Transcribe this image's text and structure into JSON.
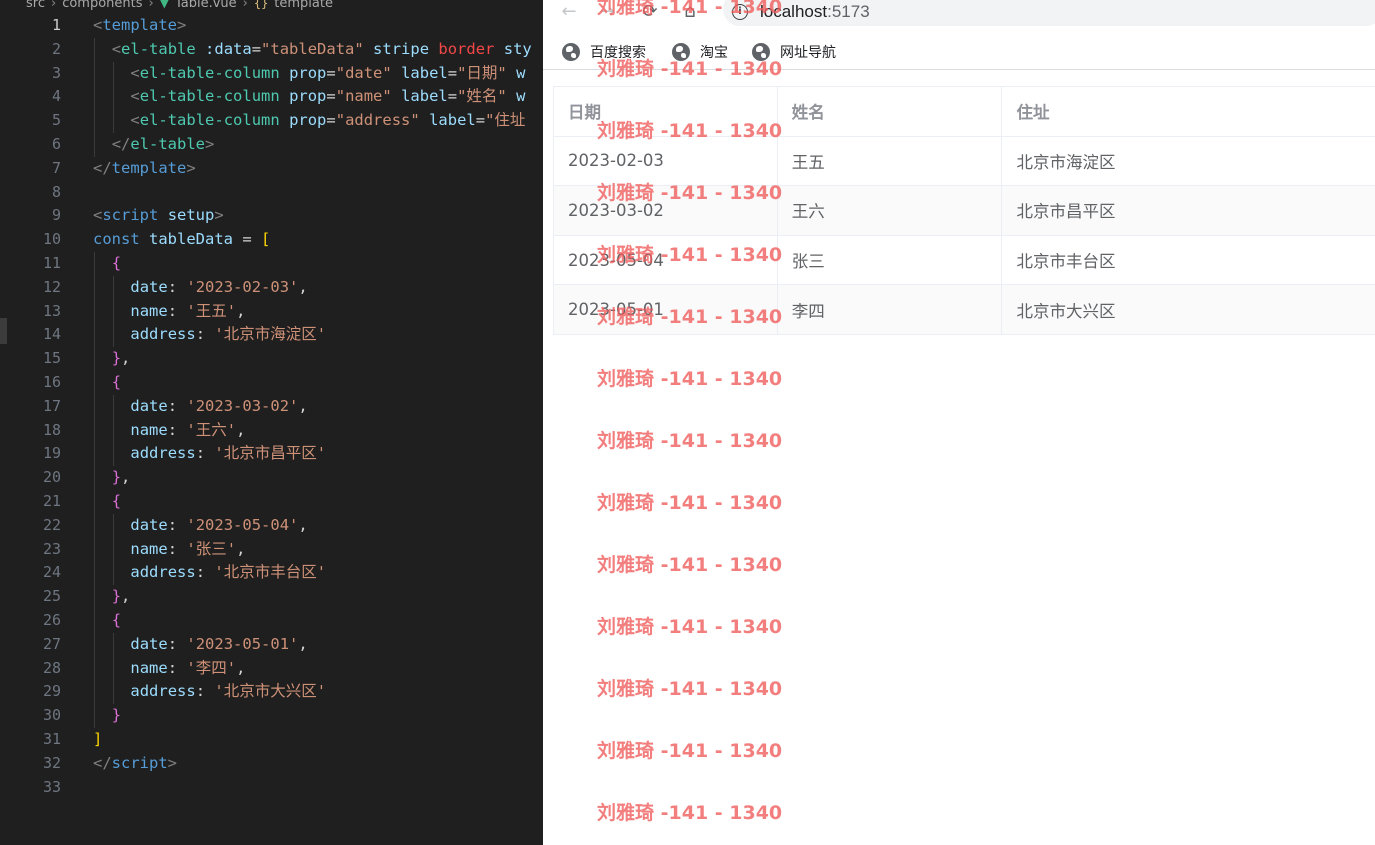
{
  "editor": {
    "breadcrumb": {
      "parts": [
        "src",
        "components",
        "Table.vue",
        "template"
      ]
    },
    "active_line": 1,
    "lines": [
      {
        "n": "1",
        "indent": 0,
        "tokens": [
          [
            "t-brk",
            "<"
          ],
          [
            "t-tag",
            "template"
          ],
          [
            "t-brk",
            ">"
          ]
        ]
      },
      {
        "n": "2",
        "indent": 1,
        "tokens": [
          [
            "t-brk",
            "<"
          ],
          [
            "t-comp",
            "el-table"
          ],
          [
            "t-plain",
            " "
          ],
          [
            "t-attr",
            ":data"
          ],
          [
            "t-plain",
            "="
          ],
          [
            "t-str",
            "\"tableData\""
          ],
          [
            "t-plain",
            " "
          ],
          [
            "t-attr",
            "stripe"
          ],
          [
            "t-plain",
            " "
          ],
          [
            "t-red",
            "border"
          ],
          [
            "t-plain",
            " "
          ],
          [
            "t-attr",
            "sty"
          ]
        ]
      },
      {
        "n": "3",
        "indent": 2,
        "tokens": [
          [
            "t-brk",
            "<"
          ],
          [
            "t-comp",
            "el-table-column"
          ],
          [
            "t-plain",
            " "
          ],
          [
            "t-attr",
            "prop"
          ],
          [
            "t-plain",
            "="
          ],
          [
            "t-str",
            "\"date\""
          ],
          [
            "t-plain",
            " "
          ],
          [
            "t-attr",
            "label"
          ],
          [
            "t-plain",
            "="
          ],
          [
            "t-str",
            "\"日期\""
          ],
          [
            "t-plain",
            " "
          ],
          [
            "t-attr",
            "w"
          ]
        ]
      },
      {
        "n": "4",
        "indent": 2,
        "tokens": [
          [
            "t-brk",
            "<"
          ],
          [
            "t-comp",
            "el-table-column"
          ],
          [
            "t-plain",
            " "
          ],
          [
            "t-attr",
            "prop"
          ],
          [
            "t-plain",
            "="
          ],
          [
            "t-str",
            "\"name\""
          ],
          [
            "t-plain",
            " "
          ],
          [
            "t-attr",
            "label"
          ],
          [
            "t-plain",
            "="
          ],
          [
            "t-str",
            "\"姓名\""
          ],
          [
            "t-plain",
            " "
          ],
          [
            "t-attr",
            "w"
          ]
        ]
      },
      {
        "n": "5",
        "indent": 2,
        "tokens": [
          [
            "t-brk",
            "<"
          ],
          [
            "t-comp",
            "el-table-column"
          ],
          [
            "t-plain",
            " "
          ],
          [
            "t-attr",
            "prop"
          ],
          [
            "t-plain",
            "="
          ],
          [
            "t-str",
            "\"address\""
          ],
          [
            "t-plain",
            " "
          ],
          [
            "t-attr",
            "label"
          ],
          [
            "t-plain",
            "="
          ],
          [
            "t-str",
            "\"住址"
          ]
        ]
      },
      {
        "n": "6",
        "indent": 1,
        "tokens": [
          [
            "t-brk",
            "</"
          ],
          [
            "t-comp",
            "el-table"
          ],
          [
            "t-brk",
            ">"
          ]
        ]
      },
      {
        "n": "7",
        "indent": 0,
        "tokens": [
          [
            "t-brk",
            "</"
          ],
          [
            "t-tag",
            "template"
          ],
          [
            "t-brk",
            ">"
          ]
        ]
      },
      {
        "n": "8",
        "indent": 0,
        "tokens": []
      },
      {
        "n": "9",
        "indent": 0,
        "tokens": [
          [
            "t-brk",
            "<"
          ],
          [
            "t-tag",
            "script"
          ],
          [
            "t-plain",
            " "
          ],
          [
            "t-attr",
            "setup"
          ],
          [
            "t-brk",
            ">"
          ]
        ]
      },
      {
        "n": "10",
        "indent": 0,
        "tokens": [
          [
            "t-key",
            "const"
          ],
          [
            "t-plain",
            " "
          ],
          [
            "t-var",
            "tableData"
          ],
          [
            "t-plain",
            " = "
          ],
          [
            "t-b1",
            "["
          ]
        ]
      },
      {
        "n": "11",
        "indent": 1,
        "tokens": [
          [
            "t-b2",
            "{"
          ]
        ]
      },
      {
        "n": "12",
        "indent": 2,
        "tokens": [
          [
            "t-prop",
            "date"
          ],
          [
            "t-plain",
            ": "
          ],
          [
            "t-str",
            "'2023-02-03'"
          ],
          [
            "t-plain",
            ","
          ]
        ]
      },
      {
        "n": "13",
        "indent": 2,
        "tokens": [
          [
            "t-prop",
            "name"
          ],
          [
            "t-plain",
            ": "
          ],
          [
            "t-str",
            "'王五'"
          ],
          [
            "t-plain",
            ","
          ]
        ]
      },
      {
        "n": "14",
        "indent": 2,
        "tokens": [
          [
            "t-prop",
            "address"
          ],
          [
            "t-plain",
            ": "
          ],
          [
            "t-str",
            "'北京市海淀区'"
          ]
        ]
      },
      {
        "n": "15",
        "indent": 1,
        "tokens": [
          [
            "t-b2",
            "}"
          ],
          [
            "t-plain",
            ","
          ]
        ]
      },
      {
        "n": "16",
        "indent": 1,
        "tokens": [
          [
            "t-b2",
            "{"
          ]
        ]
      },
      {
        "n": "17",
        "indent": 2,
        "tokens": [
          [
            "t-prop",
            "date"
          ],
          [
            "t-plain",
            ": "
          ],
          [
            "t-str",
            "'2023-03-02'"
          ],
          [
            "t-plain",
            ","
          ]
        ]
      },
      {
        "n": "18",
        "indent": 2,
        "tokens": [
          [
            "t-prop",
            "name"
          ],
          [
            "t-plain",
            ": "
          ],
          [
            "t-str",
            "'王六'"
          ],
          [
            "t-plain",
            ","
          ]
        ]
      },
      {
        "n": "19",
        "indent": 2,
        "tokens": [
          [
            "t-prop",
            "address"
          ],
          [
            "t-plain",
            ": "
          ],
          [
            "t-str",
            "'北京市昌平区'"
          ]
        ]
      },
      {
        "n": "20",
        "indent": 1,
        "tokens": [
          [
            "t-b2",
            "}"
          ],
          [
            "t-plain",
            ","
          ]
        ]
      },
      {
        "n": "21",
        "indent": 1,
        "tokens": [
          [
            "t-b2",
            "{"
          ]
        ]
      },
      {
        "n": "22",
        "indent": 2,
        "tokens": [
          [
            "t-prop",
            "date"
          ],
          [
            "t-plain",
            ": "
          ],
          [
            "t-str",
            "'2023-05-04'"
          ],
          [
            "t-plain",
            ","
          ]
        ]
      },
      {
        "n": "23",
        "indent": 2,
        "tokens": [
          [
            "t-prop",
            "name"
          ],
          [
            "t-plain",
            ": "
          ],
          [
            "t-str",
            "'张三'"
          ],
          [
            "t-plain",
            ","
          ]
        ]
      },
      {
        "n": "24",
        "indent": 2,
        "tokens": [
          [
            "t-prop",
            "address"
          ],
          [
            "t-plain",
            ": "
          ],
          [
            "t-str",
            "'北京市丰台区'"
          ]
        ]
      },
      {
        "n": "25",
        "indent": 1,
        "tokens": [
          [
            "t-b2",
            "}"
          ],
          [
            "t-plain",
            ","
          ]
        ]
      },
      {
        "n": "26",
        "indent": 1,
        "tokens": [
          [
            "t-b2",
            "{"
          ]
        ]
      },
      {
        "n": "27",
        "indent": 2,
        "tokens": [
          [
            "t-prop",
            "date"
          ],
          [
            "t-plain",
            ": "
          ],
          [
            "t-str",
            "'2023-05-01'"
          ],
          [
            "t-plain",
            ","
          ]
        ]
      },
      {
        "n": "28",
        "indent": 2,
        "tokens": [
          [
            "t-prop",
            "name"
          ],
          [
            "t-plain",
            ": "
          ],
          [
            "t-str",
            "'李四'"
          ],
          [
            "t-plain",
            ","
          ]
        ]
      },
      {
        "n": "29",
        "indent": 2,
        "tokens": [
          [
            "t-prop",
            "address"
          ],
          [
            "t-plain",
            ": "
          ],
          [
            "t-str",
            "'北京市大兴区'"
          ]
        ]
      },
      {
        "n": "30",
        "indent": 1,
        "tokens": [
          [
            "t-b2",
            "}"
          ]
        ]
      },
      {
        "n": "31",
        "indent": 0,
        "tokens": [
          [
            "t-b1",
            "]"
          ]
        ]
      },
      {
        "n": "32",
        "indent": 0,
        "tokens": [
          [
            "t-brk",
            "</"
          ],
          [
            "t-tag",
            "script"
          ],
          [
            "t-brk",
            ">"
          ]
        ]
      },
      {
        "n": "33",
        "indent": 0,
        "tokens": []
      }
    ]
  },
  "browser": {
    "nav": {
      "back_icon": "←",
      "forward_icon": "→",
      "reload_icon": "⟳",
      "home_icon": "⌂"
    },
    "url_host": "localhost",
    "url_port": ":5173",
    "bookmarks": [
      "百度搜索",
      "淘宝",
      "网址导航"
    ],
    "table": {
      "headers": [
        "日期",
        "姓名",
        "住址"
      ],
      "rows": [
        [
          "2023-02-03",
          "王五",
          "北京市海淀区"
        ],
        [
          "2023-03-02",
          "王六",
          "北京市昌平区"
        ],
        [
          "2023-05-04",
          "张三",
          "北京市丰台区"
        ],
        [
          "2023-05-01",
          "李四",
          "北京市大兴区"
        ]
      ]
    }
  },
  "watermark": {
    "text": "刘雅琦 -141 - 1340",
    "color": "#f05a5a"
  }
}
